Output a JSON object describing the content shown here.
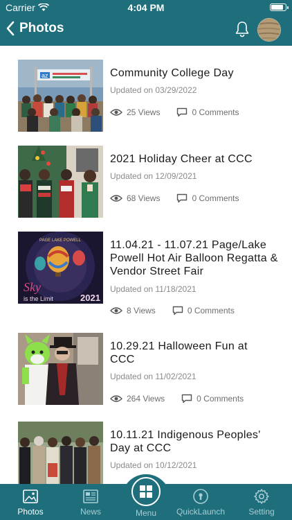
{
  "status_bar": {
    "carrier": "Carrier",
    "time": "4:04 PM",
    "battery_level": 0.9
  },
  "nav": {
    "back_label": "Photos"
  },
  "albums": [
    {
      "title": "Community College Day",
      "updated": "Updated on 03/29/2022",
      "views": "25 Views",
      "comments": "0 Comments"
    },
    {
      "title": "2021 Holiday Cheer at CCC",
      "updated": "Updated on 12/09/2021",
      "views": "68 Views",
      "comments": "0 Comments"
    },
    {
      "title": "11.04.21 - 11.07.21 Page/Lake Powell Hot Air Balloon Regatta & Vendor Street Fair",
      "updated": "Updated on 11/18/2021",
      "views": "8 Views",
      "comments": "0 Comments"
    },
    {
      "title": "10.29.21 Halloween Fun at CCC",
      "updated": "Updated on 11/02/2021",
      "views": "264 Views",
      "comments": "0 Comments"
    },
    {
      "title": "10.11.21 Indigenous Peoples' Day at CCC",
      "updated": "Updated on 10/12/2021",
      "views": "",
      "comments": ""
    }
  ],
  "thumb_text": {
    "banner": "az",
    "poster_line": "PAGE LAKE POWELL",
    "poster_sky": "Sky",
    "poster_limit": "is the Limit",
    "poster_year": "2021"
  },
  "tabs": {
    "photos": "Photos",
    "news": "News",
    "menu": "Menu",
    "quicklaunch": "QuickLaunch",
    "setting": "Setting"
  },
  "colors": {
    "brand": "#1e6e7c",
    "tab_inactive": "#a8cdd3"
  }
}
